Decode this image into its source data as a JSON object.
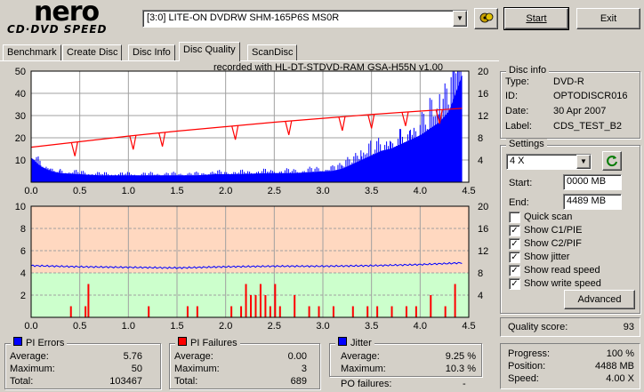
{
  "logo": {
    "brand": "nero",
    "product": "CD·DVD SPEED"
  },
  "drive": {
    "selected": "[3:0]  LITE-ON DVDRW SHM-165P6S MS0R"
  },
  "buttons": {
    "start": "Start",
    "exit": "Exit",
    "advanced": "Advanced"
  },
  "tabs": [
    "Benchmark",
    "Create Disc",
    "Disc Info",
    "Disc Quality",
    "ScanDisc"
  ],
  "active_tab": "Disc Quality",
  "chart_caption": "recorded with HL-DT-STDVD-RAM GSA-H55N v1.00",
  "disc_info": {
    "title": "Disc info",
    "type_label": "Type:",
    "type": "DVD-R",
    "id_label": "ID:",
    "id": "OPTODISCR016",
    "date_label": "Date:",
    "date": "30 Apr 2007",
    "label_label": "Label:",
    "label": "CDS_TEST_B2"
  },
  "settings": {
    "title": "Settings",
    "speed": "4 X",
    "start_label": "Start:",
    "start": "0000 MB",
    "end_label": "End:",
    "end": "4489 MB",
    "checks": [
      {
        "label": "Quick scan",
        "checked": false
      },
      {
        "label": "Show C1/PIE",
        "checked": true
      },
      {
        "label": "Show C2/PIF",
        "checked": true
      },
      {
        "label": "Show jitter",
        "checked": true
      },
      {
        "label": "Show read speed",
        "checked": true
      },
      {
        "label": "Show write speed",
        "checked": true
      }
    ]
  },
  "quality": {
    "label": "Quality score:",
    "value": "93"
  },
  "progress": {
    "progress_label": "Progress:",
    "progress": "100 %",
    "position_label": "Position:",
    "position": "4488 MB",
    "speed_label": "Speed:",
    "speed": "4.00 X"
  },
  "pi_errors": {
    "title": "PI Errors",
    "avg_label": "Average:",
    "avg": "5.76",
    "max_label": "Maximum:",
    "max": "50",
    "total_label": "Total:",
    "total": "103467",
    "color": "#0000ff"
  },
  "pi_failures": {
    "title": "PI Failures",
    "avg_label": "Average:",
    "avg": "0.00",
    "max_label": "Maximum:",
    "max": "3",
    "total_label": "Total:",
    "total": "689",
    "color": "#ff0000"
  },
  "jitter": {
    "title": "Jitter",
    "avg_label": "Average:",
    "avg": "9.25 %",
    "max_label": "Maximum:",
    "max": "10.3 %",
    "po_label": "PO failures:",
    "po": "-",
    "color": "#0000ff"
  },
  "chart_data": [
    {
      "type": "area",
      "name": "PI errors / read speed",
      "x_ticks": [
        "0.0",
        "0.5",
        "1.0",
        "1.5",
        "2.0",
        "2.5",
        "3.0",
        "3.5",
        "4.0",
        "4.5"
      ],
      "y_left_ticks": [
        "10",
        "20",
        "30",
        "40",
        "50"
      ],
      "y_right_ticks": [
        "4",
        "8",
        "12",
        "16",
        "20"
      ],
      "xlim": [
        0,
        4.5
      ],
      "ylim_left": [
        0,
        50
      ],
      "ylim_right": [
        0,
        20
      ],
      "grid": true,
      "series": [
        {
          "values_x": [
            0,
            0.1,
            0.2,
            0.3,
            0.5,
            0.7,
            0.9,
            1.1,
            1.3,
            1.5,
            1.7,
            1.9,
            2.1,
            2.3,
            2.5,
            2.7,
            2.9,
            3.1,
            3.2,
            3.3,
            3.4,
            3.5,
            3.6,
            3.7,
            3.8,
            3.9,
            4.0,
            4.1,
            4.2,
            4.3,
            4.35,
            4.4,
            4.43
          ],
          "values_y": [
            11,
            7,
            5,
            4,
            3.5,
            3,
            3,
            3,
            3,
            3,
            3,
            3.5,
            3.5,
            3.8,
            4,
            4,
            4.5,
            5,
            6,
            8,
            10,
            12,
            14,
            15,
            17,
            19,
            21,
            24,
            27,
            32,
            38,
            44,
            48
          ],
          "color": "#0000ff"
        },
        {
          "values_x": [
            0,
            0.5,
            1.0,
            1.5,
            2.0,
            2.5,
            3.0,
            3.5,
            4.0,
            4.43
          ],
          "values_y": [
            6.3,
            7.3,
            8.3,
            9.2,
            10.0,
            10.8,
            11.5,
            12.2,
            12.8,
            13.3
          ],
          "dips_x": [
            0.45,
            1.05,
            1.35,
            2.1,
            2.65,
            3.2,
            3.5,
            3.85,
            4.2
          ],
          "color": "#ff0000"
        }
      ]
    },
    {
      "type": "bar",
      "name": "PI failures / jitter",
      "x_ticks": [
        "0.0",
        "0.5",
        "1.0",
        "1.5",
        "2.0",
        "2.5",
        "3.0",
        "3.5",
        "4.0",
        "4.5"
      ],
      "y_left_ticks": [
        "2",
        "4",
        "6",
        "8",
        "10"
      ],
      "y_right_ticks": [
        "4",
        "8",
        "12",
        "16",
        "20"
      ],
      "xlim": [
        0,
        4.5
      ],
      "ylim_left": [
        0,
        10
      ],
      "ylim_right": [
        0,
        20
      ],
      "grid": true,
      "series": [
        {
          "values_x": [
            0.4,
            0.55,
            0.58,
            1.2,
            1.6,
            1.7,
            2.05,
            2.15,
            2.2,
            2.25,
            2.3,
            2.35,
            2.4,
            2.45,
            2.5,
            2.55,
            2.7,
            2.85,
            2.95,
            3.1,
            3.3,
            3.45,
            3.55,
            3.7,
            3.85,
            3.95,
            4.1,
            4.25,
            4.35
          ],
          "values_y": [
            1,
            1,
            3,
            1,
            1,
            1,
            1,
            1,
            3,
            2,
            2,
            3,
            2,
            1,
            3,
            1,
            2,
            1,
            1,
            1,
            1,
            1,
            1,
            1,
            1,
            1,
            2,
            1,
            3
          ],
          "color": "#ff0000"
        },
        {
          "values_x": [
            0,
            0.5,
            1.0,
            1.5,
            2.0,
            2.5,
            3.0,
            3.5,
            4.0,
            4.43
          ],
          "values_y": [
            9.3,
            9.1,
            9.0,
            8.9,
            9.1,
            9.2,
            9.2,
            9.3,
            9.5,
            9.8
          ],
          "color": "#0000ff"
        }
      ]
    }
  ]
}
